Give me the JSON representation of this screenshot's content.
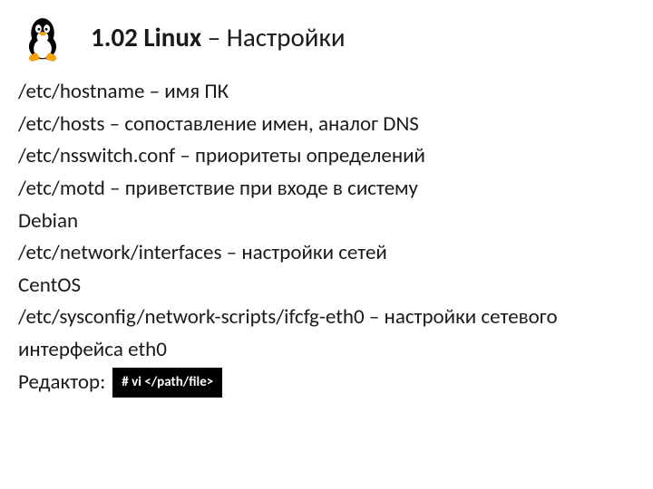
{
  "title_bold": "1.02 Linux",
  "title_rest": " – Настройки",
  "lines": {
    "l0": "/etc/hostname – имя ПК",
    "l1": "/etc/hosts – сопоставление имен, аналог DNS",
    "l2": "/etc/nsswitch.conf – приоритеты определений",
    "l3": "/etc/motd – приветствие при входе в систему",
    "l4": "Debian",
    "l5": "/etc/network/interfaces – настройки сетей",
    "l6": "CentOS",
    "l7": "/etc/sysconfig/network-scripts/ifcfg-eth0 – настройки сетевого интерфейса eth0",
    "editor_label": "Редактор:",
    "cmd": "# vi </path/file>"
  }
}
